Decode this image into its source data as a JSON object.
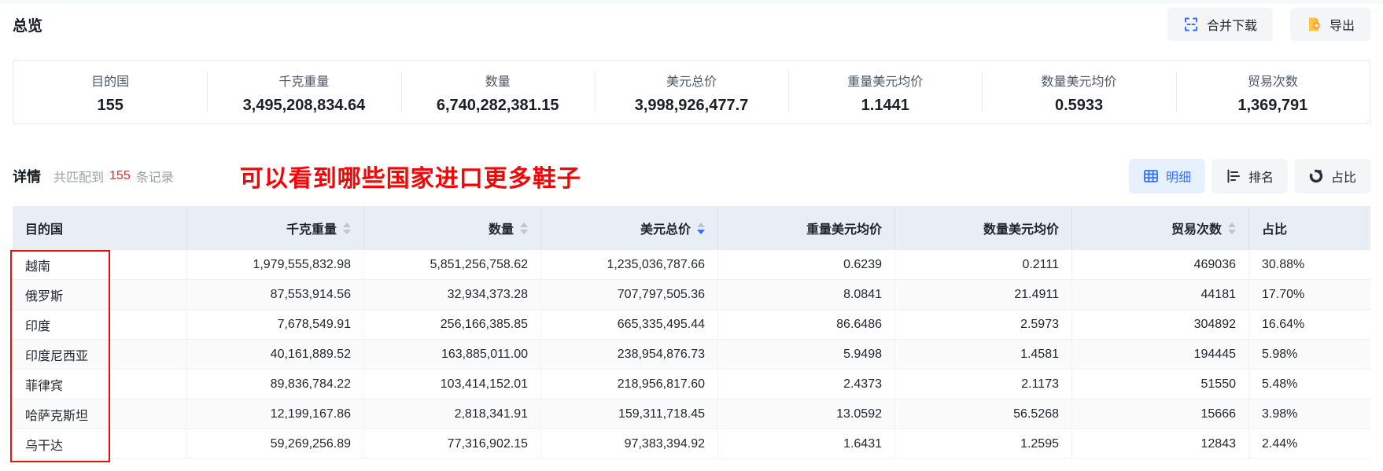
{
  "page": {
    "title": "总览",
    "toolbar": {
      "merge_download_label": "合并下载",
      "export_label": "导出"
    }
  },
  "summary": {
    "stats": [
      {
        "key": "destination-country",
        "label": "目的国",
        "value": "155"
      },
      {
        "key": "kg-weight",
        "label": "千克重量",
        "value": "3,495,208,834.64"
      },
      {
        "key": "quantity",
        "label": "数量",
        "value": "6,740,282,381.15"
      },
      {
        "key": "usd-total",
        "label": "美元总价",
        "value": "3,998,926,477.7"
      },
      {
        "key": "usd-per-kg",
        "label": "重量美元均价",
        "value": "1.1441"
      },
      {
        "key": "usd-per-unit",
        "label": "数量美元均价",
        "value": "0.5933"
      },
      {
        "key": "trade-count",
        "label": "贸易次数",
        "value": "1,369,791"
      }
    ]
  },
  "detail": {
    "title": "详情",
    "match_prefix": "共匹配到",
    "match_count": "155",
    "match_suffix": "条记录",
    "annotation": "可以看到哪些国家进口更多鞋子",
    "view_tabs": [
      {
        "key": "detail",
        "label": "明细",
        "icon": "table-icon",
        "active": true
      },
      {
        "key": "ranking",
        "label": "排名",
        "icon": "ranking-icon",
        "active": false
      },
      {
        "key": "proportion",
        "label": "占比",
        "icon": "donut-icon",
        "active": false
      }
    ]
  },
  "table": {
    "columns": [
      {
        "key": "destination-country",
        "label": "目的国",
        "align": "left",
        "sortable": false,
        "sort": null
      },
      {
        "key": "kg-weight",
        "label": "千克重量",
        "align": "right",
        "sortable": true,
        "sort": null
      },
      {
        "key": "quantity",
        "label": "数量",
        "align": "right",
        "sortable": true,
        "sort": null
      },
      {
        "key": "usd-total",
        "label": "美元总价",
        "align": "right",
        "sortable": true,
        "sort": "desc"
      },
      {
        "key": "usd-per-kg",
        "label": "重量美元均价",
        "align": "right",
        "sortable": false,
        "sort": null
      },
      {
        "key": "usd-per-unit",
        "label": "数量美元均价",
        "align": "right",
        "sortable": false,
        "sort": null
      },
      {
        "key": "trade-count",
        "label": "贸易次数",
        "align": "right",
        "sortable": true,
        "sort": null
      },
      {
        "key": "share",
        "label": "占比",
        "align": "left",
        "sortable": false,
        "sort": null
      }
    ],
    "rows": [
      [
        "越南",
        "1,979,555,832.98",
        "5,851,256,758.62",
        "1,235,036,787.66",
        "0.6239",
        "0.2111",
        "469036",
        "30.88%"
      ],
      [
        "俄罗斯",
        "87,553,914.56",
        "32,934,373.28",
        "707,797,505.36",
        "8.0841",
        "21.4911",
        "44181",
        "17.70%"
      ],
      [
        "印度",
        "7,678,549.91",
        "256,166,385.85",
        "665,335,495.44",
        "86.6486",
        "2.5973",
        "304892",
        "16.64%"
      ],
      [
        "印度尼西亚",
        "40,161,889.52",
        "163,885,011.00",
        "238,954,876.73",
        "5.9498",
        "1.4581",
        "194445",
        "5.98%"
      ],
      [
        "菲律宾",
        "89,836,784.22",
        "103,414,152.01",
        "218,956,817.60",
        "2.4373",
        "2.1173",
        "51550",
        "5.48%"
      ],
      [
        "哈萨克斯坦",
        "12,199,167.86",
        "2,818,341.91",
        "159,311,718.45",
        "13.0592",
        "56.5268",
        "15666",
        "3.98%"
      ],
      [
        "乌干达",
        "59,269,256.89",
        "77,316,902.15",
        "97,383,394.92",
        "1.6431",
        "1.2595",
        "12843",
        "2.44%"
      ]
    ]
  },
  "colors": {
    "accent": "#3370ff",
    "active_tab_bg": "#e7f1fe",
    "table_header_bg": "#e9edf6",
    "annotation_red": "#f40606",
    "red_box_border": "#e8100c",
    "match_count_red": "#f5222d",
    "export_icon_yellow": "#ffc53d",
    "export_icon_orange": "#ff9c2e"
  }
}
